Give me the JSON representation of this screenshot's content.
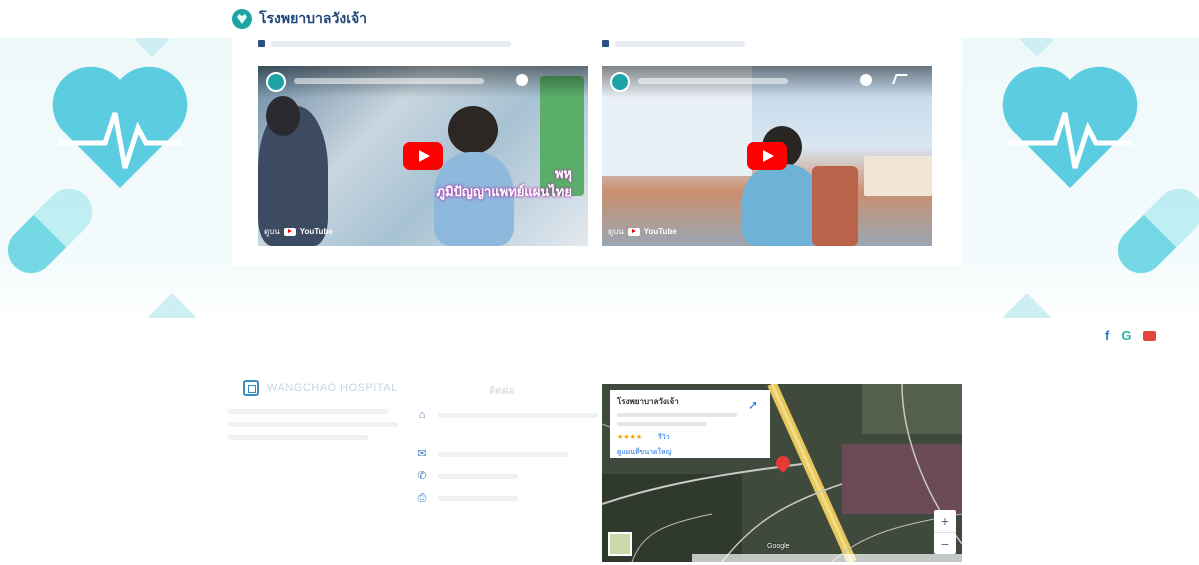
{
  "brand": {
    "name": "โรงพยาบาลวังเจ้า"
  },
  "nav": {
    "items": [
      "",
      "",
      "",
      "",
      ""
    ]
  },
  "videos": [
    {
      "overlay_line1": "พหุ",
      "overlay_line2": "ภูมิปัญญาแพทย์แผนไทย",
      "watch_prefix": "ดูบน",
      "yt_label": "YouTube"
    },
    {
      "watch_prefix": "ดูบน",
      "yt_label": "YouTube"
    }
  ],
  "social": {
    "facebook": "f",
    "google": "G"
  },
  "footer": {
    "hospital_name": "WANGCHAO HOSPITAL",
    "contact_title": "ติดต่อ"
  },
  "map": {
    "place_name": "โรงพยาบาลวังเจ้า",
    "stars": "★★★★",
    "reviews_link": "รีวิว",
    "larger_map_link": "ดูแผนที่ขนาดใหญ่",
    "directions_label": "เส้นทาง",
    "zoom_in": "+",
    "zoom_out": "−",
    "google_label": "Google"
  }
}
